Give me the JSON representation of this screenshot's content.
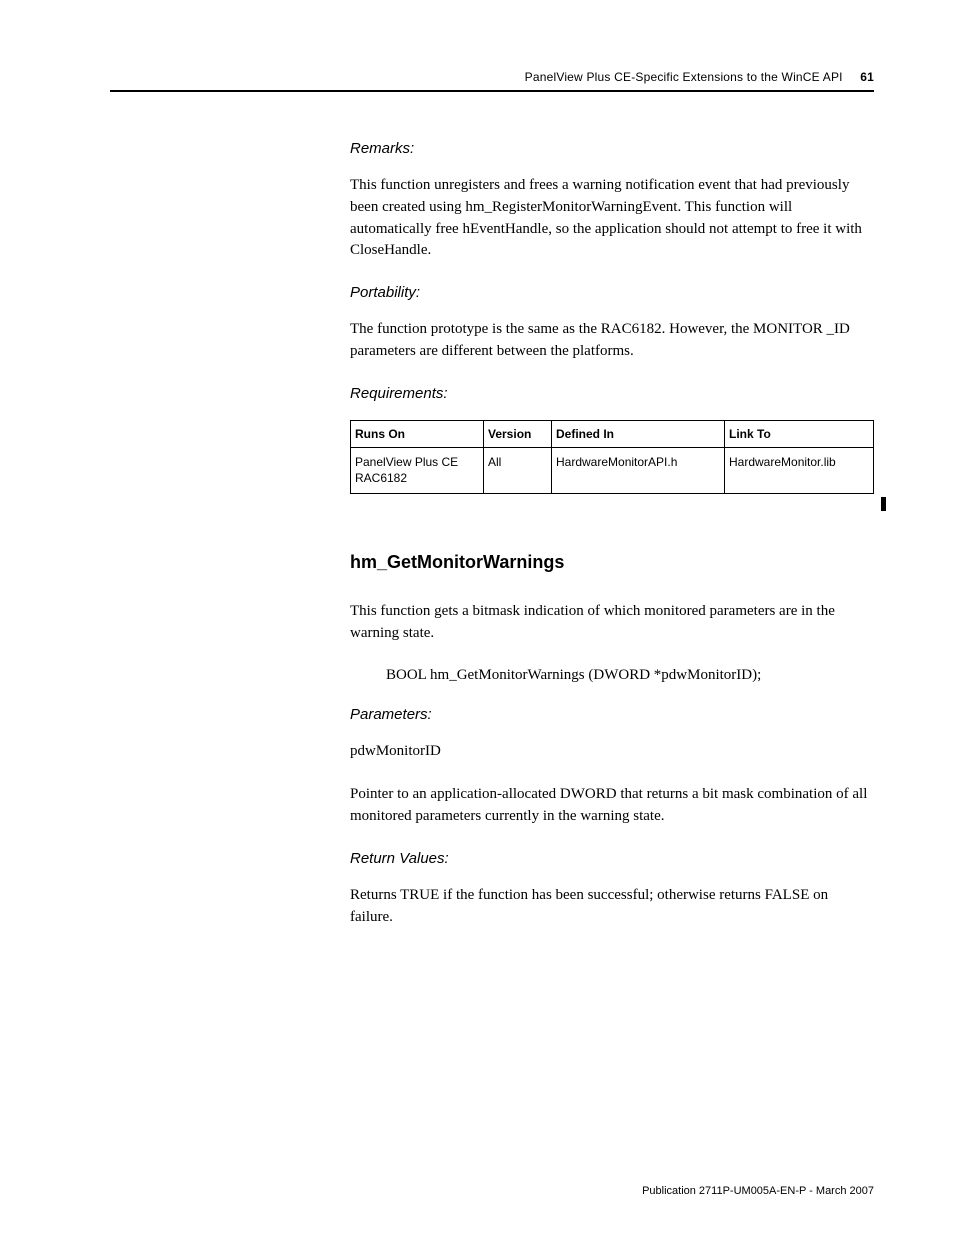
{
  "header": {
    "title": "PanelView Plus CE-Specific Extensions to the WinCE API",
    "page_number": "61"
  },
  "section1": {
    "remarks_heading": "Remarks:",
    "remarks_body": "This function unregisters and frees a warning notification event that had previously been created using hm_RegisterMonitorWarningEvent. This function will automatically free hEventHandle, so the application should not attempt to free it with CloseHandle.",
    "portability_heading": "Portability:",
    "portability_body": "The function prototype is the same as the RAC6182. However, the MONITOR _ID parameters are different between the platforms.",
    "requirements_heading": "Requirements:"
  },
  "table": {
    "headers": {
      "c1": "Runs On",
      "c2": "Version",
      "c3": "Defined In",
      "c4": "Link To"
    },
    "row": {
      "c1": "PanelView Plus CE RAC6182",
      "c2": "All",
      "c3": "HardwareMonitorAPI.h",
      "c4": "HardwareMonitor.lib"
    }
  },
  "section2": {
    "heading": "hm_GetMonitorWarnings",
    "intro": "This function gets a bitmask indication of which monitored parameters are in the warning state.",
    "signature": "BOOL hm_GetMonitorWarnings (DWORD *pdwMonitorID);",
    "parameters_heading": "Parameters:",
    "param_name": "pdwMonitorID",
    "param_desc": "Pointer to an application-allocated DWORD that returns a bit mask combination of all monitored parameters currently in the warning state.",
    "return_heading": "Return Values:",
    "return_body": "Returns TRUE if the function has been successful; otherwise returns FALSE on failure."
  },
  "footer": {
    "publication": "Publication 2711P-UM005A-EN-P - March 2007"
  }
}
